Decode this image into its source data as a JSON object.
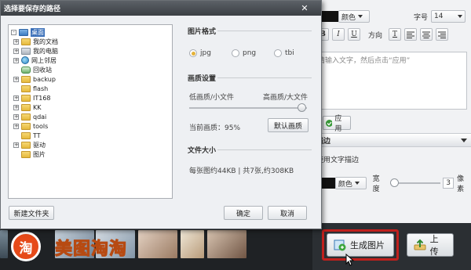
{
  "dialog": {
    "title": "选择要保存的路径",
    "tree": [
      {
        "label": "桌面",
        "expander": "-",
        "icon": "desktop-icon",
        "selected": true
      },
      {
        "label": "我的文档",
        "expander": "+",
        "icon": "folder-icon"
      },
      {
        "label": "我的电脑",
        "expander": "+",
        "icon": "computer-icon"
      },
      {
        "label": "网上邻居",
        "expander": "+",
        "icon": "network-icon"
      },
      {
        "label": "回收站",
        "expander": "",
        "icon": "recycle-bin-icon"
      },
      {
        "label": "backup",
        "expander": "+",
        "icon": "folder-icon"
      },
      {
        "label": "flash",
        "expander": "",
        "icon": "folder-icon"
      },
      {
        "label": "IT168",
        "expander": "+",
        "icon": "folder-icon"
      },
      {
        "label": "KK",
        "expander": "+",
        "icon": "folder-icon"
      },
      {
        "label": "qdai",
        "expander": "+",
        "icon": "folder-icon"
      },
      {
        "label": "tools",
        "expander": "+",
        "icon": "folder-icon"
      },
      {
        "label": "TT",
        "expander": "",
        "icon": "folder-icon"
      },
      {
        "label": "驱动",
        "expander": "+",
        "icon": "folder-icon"
      },
      {
        "label": "图片",
        "expander": "",
        "icon": "folder-icon"
      }
    ],
    "format": {
      "title": "图片格式",
      "options": [
        "jpg",
        "png",
        "tbi"
      ],
      "selected": "jpg"
    },
    "quality": {
      "title": "画质设置",
      "low_label": "低画质/小文件",
      "high_label": "高画质/大文件",
      "current_label": "当前画质：95%",
      "level_percent": 95,
      "default_button": "默认画质"
    },
    "filesize": {
      "title": "文件大小",
      "info": "每张图约44KB | 共7张,约308KB"
    },
    "new_folder_button": "新建文件夹",
    "ok_button": "确定",
    "cancel_button": "取消"
  },
  "right_panel": {
    "color_label": "颜色",
    "font_size_label": "字号",
    "font_size_value": "14",
    "bold": "B",
    "italic": "I",
    "underline": "U",
    "direction_label": "方向",
    "text_placeholder": "请输入文字，然后点击“应用”",
    "apply_button": "应用",
    "stroke_section": "描边",
    "stroke_checkbox": "使用文字描边",
    "stroke_color_label": "颜色",
    "width_label": "宽度",
    "width_value": "3",
    "width_unit": "像素"
  },
  "bottom": {
    "logo_char": "淘",
    "logo_text": "美图淘淘",
    "generate_button": "生成图片",
    "upload_button": "上传"
  }
}
